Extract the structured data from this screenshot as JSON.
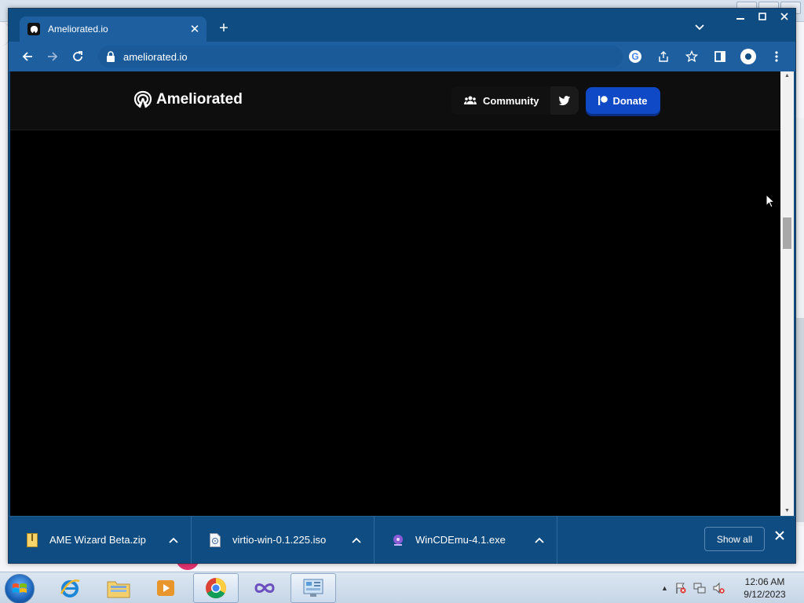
{
  "browser": {
    "tab_title": "Ameliorated.io",
    "url": "ameliorated.io"
  },
  "site": {
    "logo_text": "Ameliorated",
    "nav": {
      "community_label": "Community",
      "donate_label": "Donate"
    }
  },
  "downloads": {
    "items": [
      {
        "name": "AME Wizard Beta.zip",
        "icon": "zip-file-icon"
      },
      {
        "name": "virtio-win-0.1.225.iso",
        "icon": "disc-image-icon"
      },
      {
        "name": "WinCDEmu-4.1.exe",
        "icon": "installer-icon"
      }
    ],
    "show_all_label": "Show all"
  },
  "taskbar": {
    "clock_time": "12:06 AM",
    "clock_date": "9/12/2023"
  },
  "colors": {
    "browser_frame": "#0f4c81",
    "toolbar": "#1e5fa0",
    "page_background": "#000000",
    "header_background": "#0e0e0e",
    "donate_button": "#1049c5"
  }
}
